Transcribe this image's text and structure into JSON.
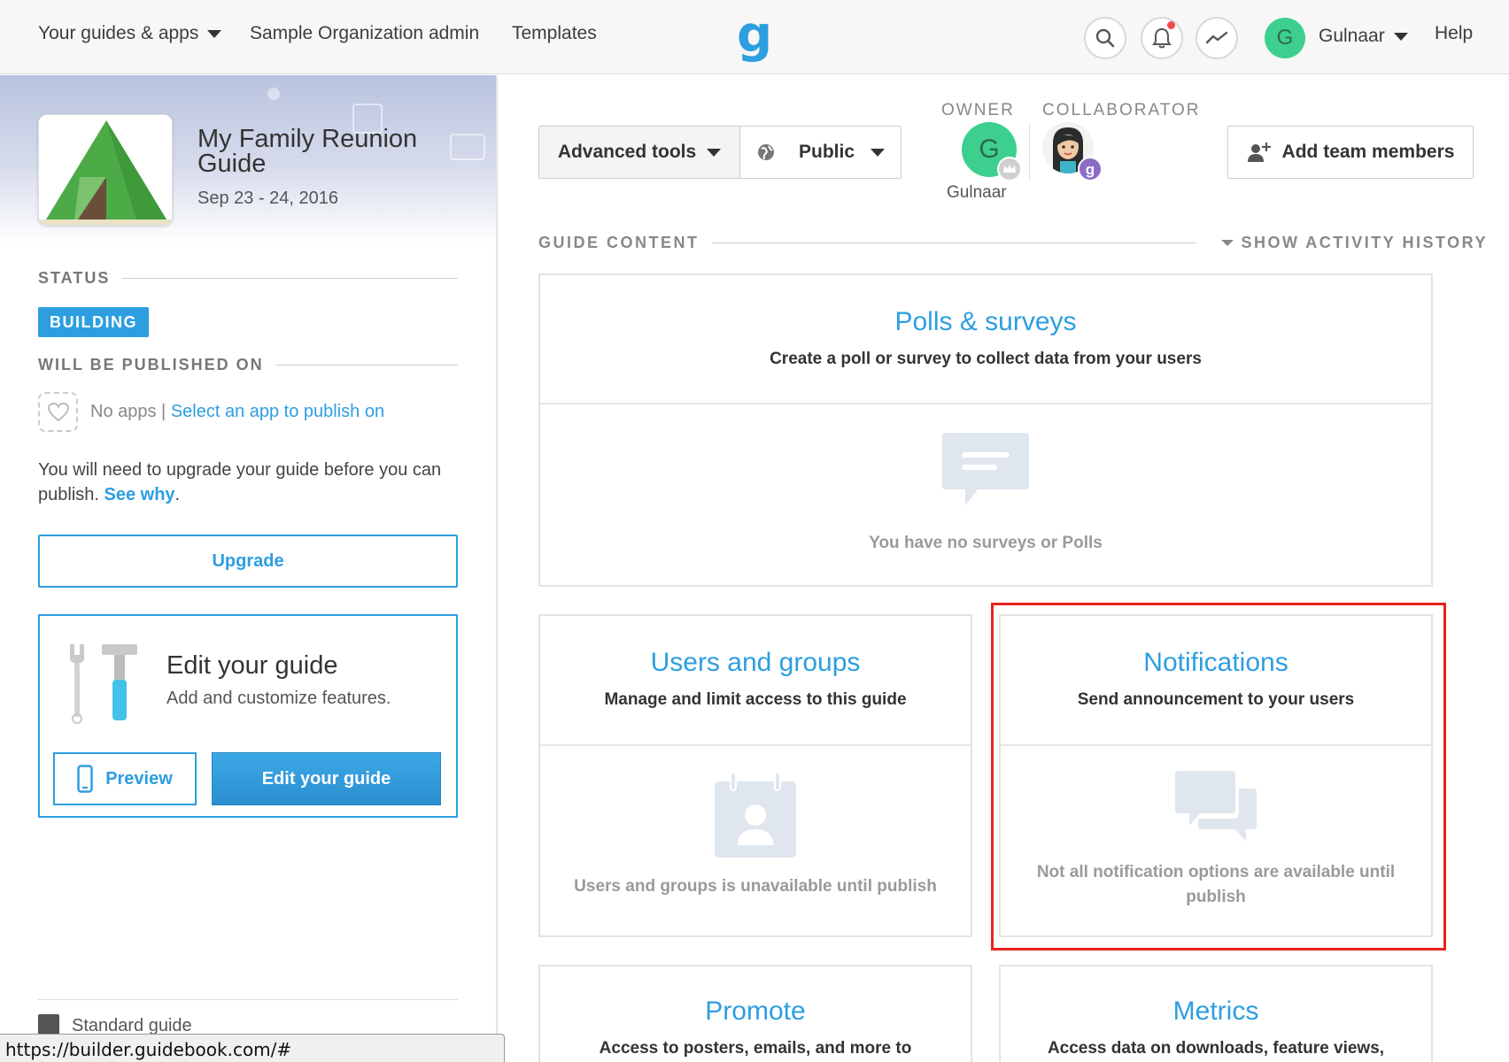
{
  "nav": {
    "guides_apps": "Your guides & apps",
    "admin": "Sample Organization admin",
    "templates": "Templates",
    "logo": "g",
    "user_initial": "G",
    "user_name": "Gulnaar",
    "help": "Help"
  },
  "sidebar": {
    "guide_title": "My Family Reunion Guide",
    "guide_dates": "Sep 23 - 24, 2016",
    "status_label": "STATUS",
    "status_badge": "BUILDING",
    "publish_label": "WILL BE PUBLISHED ON",
    "no_apps": "No apps",
    "separator": " | ",
    "select_app": "Select an app to publish on",
    "upgrade_note": "You will need to upgrade your guide before you can publish.",
    "see_why": "See why",
    "period": ".",
    "upgrade_button": "Upgrade",
    "edit_card_title": "Edit your guide",
    "edit_card_sub": "Add and customize features.",
    "preview_button": "Preview",
    "edit_button": "Edit your guide",
    "plan": "Standard guide"
  },
  "toolbar": {
    "advanced_tools": "Advanced tools",
    "visibility": "Public",
    "owner_label": "OWNER",
    "owner_initial": "G",
    "owner_name": "Gulnaar",
    "collaborator_label": "COLLABORATOR",
    "collab_badge": "g",
    "add_team": "Add team members"
  },
  "content": {
    "section_label": "GUIDE CONTENT",
    "activity_history": "SHOW ACTIVITY HISTORY",
    "cards": {
      "polls": {
        "title": "Polls & surveys",
        "desc": "Create a poll or survey to collect data from your users",
        "empty": "You have no surveys or Polls"
      },
      "users": {
        "title": "Users and groups",
        "desc": "Manage and limit access to this guide",
        "empty": "Users and groups is unavailable until publish"
      },
      "notifications": {
        "title": "Notifications",
        "desc": "Send announcement to your users",
        "empty": "Not all notification options are available until publish"
      },
      "promote": {
        "title": "Promote",
        "desc": "Access to posters, emails, and more to"
      },
      "metrics": {
        "title": "Metrics",
        "desc": "Access data on downloads, feature views,"
      }
    }
  },
  "status_bar": {
    "url": "https://builder.guidebook.com/#"
  },
  "colors": {
    "accent": "#2d9ee0",
    "user_green": "#3ccf8e",
    "highlight": "#e8231c"
  }
}
